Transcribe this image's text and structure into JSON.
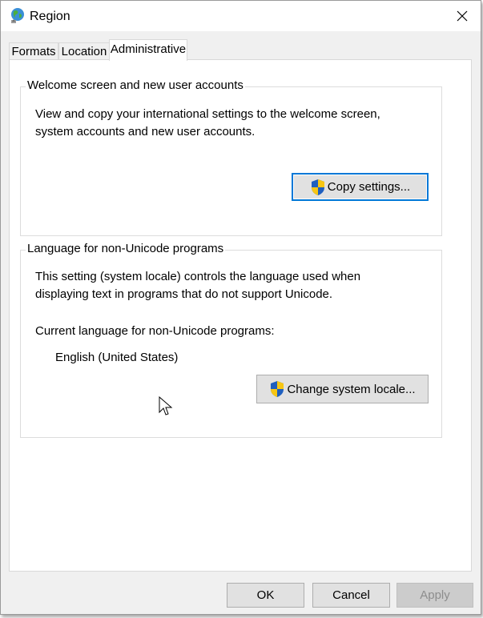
{
  "window": {
    "title": "Region",
    "icon": "globe-region-icon",
    "close_icon": "close-icon"
  },
  "tabs": [
    {
      "label": "Formats",
      "active": false
    },
    {
      "label": "Location",
      "active": false
    },
    {
      "label": "Administrative",
      "active": true
    }
  ],
  "welcome_group": {
    "title": "Welcome screen and new user accounts",
    "description": [
      "View and copy your international settings to the welcome screen,",
      "system accounts and new user accounts."
    ],
    "button_label": "Copy settings...",
    "button_icon": "uac-shield-icon"
  },
  "language_group": {
    "title": "Language for non-Unicode programs",
    "description": [
      "This setting (system locale) controls the language used when",
      "displaying text in programs that do not support Unicode."
    ],
    "current_label": "Current language for non-Unicode programs:",
    "current_value": "English (United States)",
    "button_label": "Change system locale...",
    "button_icon": "uac-shield-icon"
  },
  "footer": {
    "ok_label": "OK",
    "cancel_label": "Cancel",
    "apply_label": "Apply"
  },
  "colors": {
    "accent": "#0078d7",
    "window_bg": "#f0f0f0",
    "panel_bg": "#ffffff",
    "button_bg": "#e1e1e1"
  }
}
